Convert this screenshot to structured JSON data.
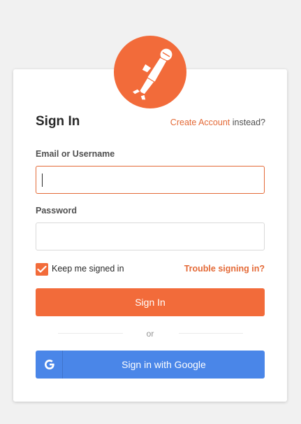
{
  "brand": {
    "icon": "postman-logo-icon",
    "color": "#f26b3a"
  },
  "form": {
    "title": "Sign In",
    "create_account_link": "Create Account",
    "create_account_suffix": " instead?",
    "email_label": "Email or Username",
    "email_value": "",
    "password_label": "Password",
    "password_value": "",
    "keep_signed_in_label": "Keep me signed in",
    "keep_signed_in_checked": true,
    "trouble_link": "Trouble signing in?",
    "signin_button": "Sign In",
    "divider_text": "or",
    "google_button": "Sign in with Google",
    "google_icon": "google-g-icon"
  },
  "colors": {
    "accent": "#f26b3a",
    "link": "#e46a37",
    "google": "#4a86e8",
    "background": "#f1f1f1"
  }
}
